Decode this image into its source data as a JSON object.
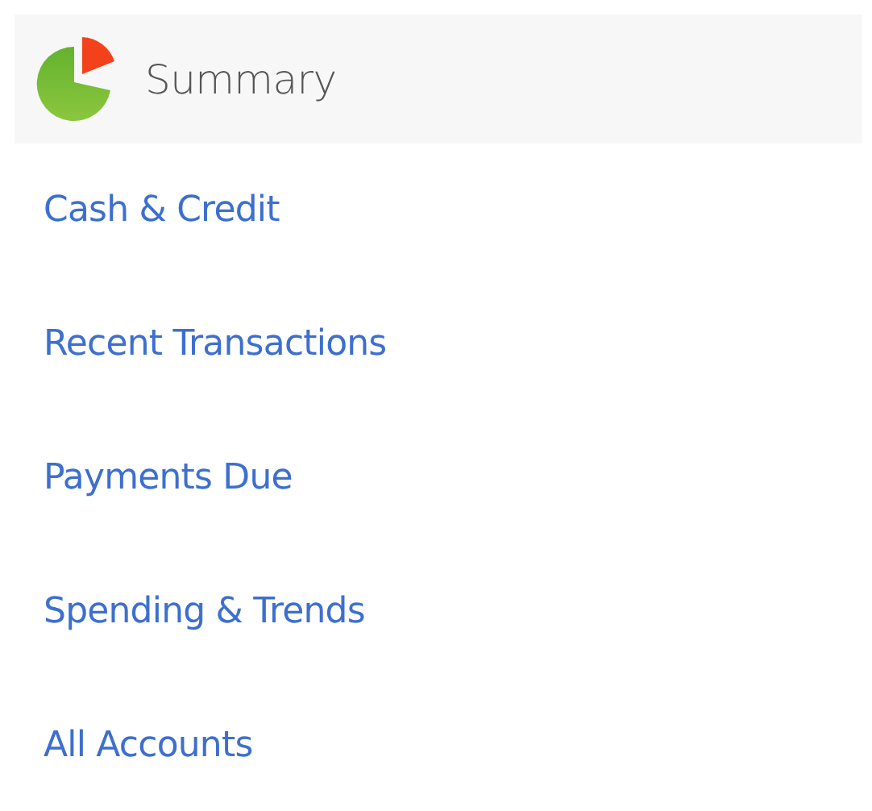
{
  "header": {
    "title": "Summary"
  },
  "links": [
    {
      "label": "Cash & Credit"
    },
    {
      "label": "Recent Transactions"
    },
    {
      "label": "Payments Due"
    },
    {
      "label": "Spending & Trends"
    },
    {
      "label": "All Accounts"
    }
  ]
}
